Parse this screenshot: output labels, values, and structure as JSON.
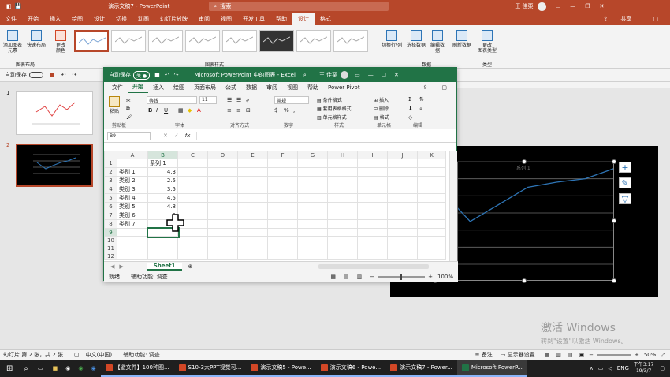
{
  "ppt": {
    "doc_title": "演示文稿7 - PowerPoint",
    "search": "搜索",
    "user": "王 佳栗",
    "share": "共享",
    "tabs": [
      "文件",
      "开始",
      "插入",
      "绘图",
      "设计",
      "切换",
      "动画",
      "幻灯片放映",
      "审阅",
      "视图",
      "开发工具",
      "帮助",
      "设计",
      "格式"
    ],
    "ribbon": {
      "add_element": "添加图表\n元素",
      "quick_layout": "快速布局",
      "change_colors": "更改\n颜色",
      "group_layout": "图表布局",
      "group_styles": "图表样式",
      "switch_row_col": "切换行/列",
      "select_data": "选择数据",
      "edit_data": "编辑数\n据",
      "refresh_data": "刷新数据",
      "group_data": "数据",
      "change_type": "更改\n图表类型",
      "group_type": "类型"
    },
    "qat_autosave": "自动保存",
    "slides": [
      "1",
      "2"
    ],
    "status": {
      "slide_info": "幻灯片 第 2 张，共 2 张",
      "lang": "中文(中国)",
      "access": "辅助功能: 调查",
      "notes": "备注",
      "display": "显示器设置",
      "zoom": "50%"
    }
  },
  "excel": {
    "autosave": "自动保存",
    "toggle": "关",
    "title": "Microsoft PowerPoint 中的图表 - Excel",
    "user": "王 佳栗",
    "tabs": [
      "文件",
      "开始",
      "插入",
      "绘图",
      "页面布局",
      "公式",
      "数据",
      "审阅",
      "视图",
      "帮助",
      "Power Pivot"
    ],
    "ribbon": {
      "paste": "粘贴",
      "font": "等线",
      "size": "11",
      "number_format": "常规",
      "cond_format": "条件格式",
      "table_format": "套用表格格式",
      "cell_style": "单元格样式",
      "insert": "插入",
      "delete": "删除",
      "format": "格式",
      "groups": [
        "剪贴板",
        "字体",
        "对齐方式",
        "数字",
        "样式",
        "单元格",
        "编辑"
      ]
    },
    "namebox": "B9",
    "fx": "fx",
    "columns": [
      "A",
      "B",
      "C",
      "D",
      "E",
      "F",
      "G",
      "H",
      "I",
      "J",
      "K"
    ],
    "rows": [
      {
        "n": "1",
        "a": "",
        "b": "系列 1"
      },
      {
        "n": "2",
        "a": "类别 1",
        "b": "4.3"
      },
      {
        "n": "3",
        "a": "类别 2",
        "b": "2.5"
      },
      {
        "n": "4",
        "a": "类别 3",
        "b": "3.5"
      },
      {
        "n": "5",
        "a": "类别 4",
        "b": "4.5"
      },
      {
        "n": "6",
        "a": "类别 5",
        "b": "4.8"
      },
      {
        "n": "7",
        "a": "类别 6",
        "b": "5"
      },
      {
        "n": "8",
        "a": "类别 7",
        "b": ""
      },
      {
        "n": "9",
        "a": "",
        "b": ""
      },
      {
        "n": "10",
        "a": "",
        "b": ""
      },
      {
        "n": "11",
        "a": "",
        "b": ""
      },
      {
        "n": "12",
        "a": "",
        "b": ""
      }
    ],
    "sheet": "Sheet1",
    "status_ready": "就绪",
    "status_access": "辅助功能: 调查",
    "zoom": "100%"
  },
  "slide_chart": {
    "series_label": "系列 1",
    "values": [
      4.3,
      2.5,
      3.5,
      4.5,
      4.8,
      5,
      5.6
    ],
    "ylim": [
      0,
      6
    ]
  },
  "watermark": {
    "line1": "激活 Windows",
    "line2": "转到\"设置\"以激活 Windows。"
  },
  "taskbar": {
    "items": [
      "【避文件】100种图...",
      "S10-3大PPT视觉可...",
      "演示文稿5 - Powe...",
      "演示文稿6 - Powe...",
      "演示文稿7 - Power...",
      "Microsoft PowerP..."
    ],
    "lang": "ENG",
    "time": "下午3:17",
    "date": "19/3/7"
  },
  "colors": {
    "ppt": "#b7472a",
    "excel": "#217346",
    "line": "#2e75b6"
  }
}
